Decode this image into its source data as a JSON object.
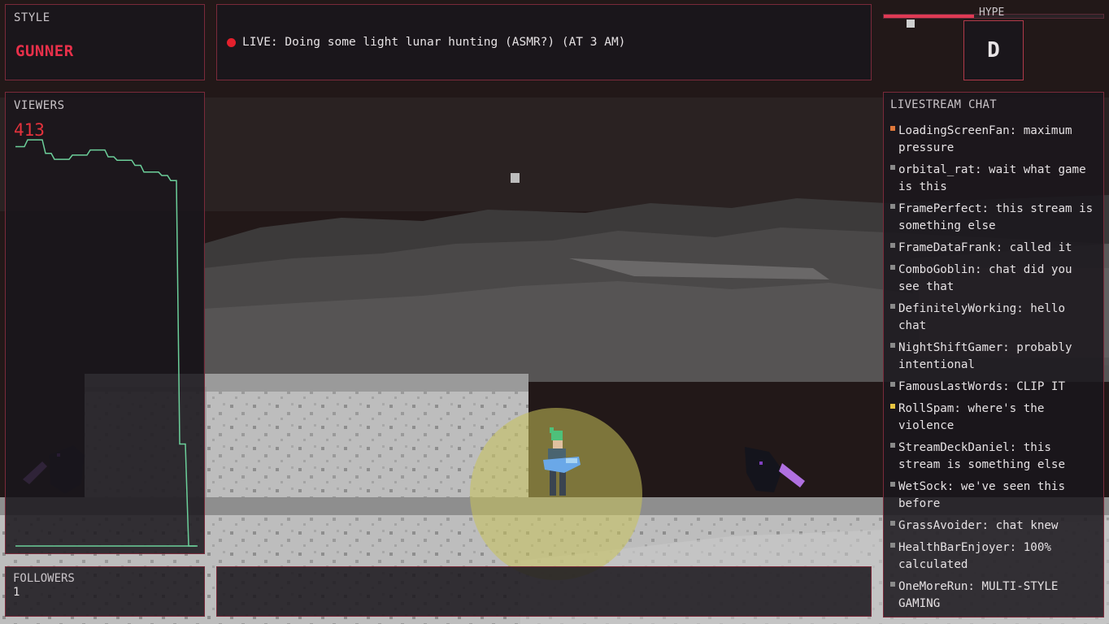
{
  "style_panel": {
    "title": "STYLE",
    "value": "GUNNER"
  },
  "live_banner": {
    "text": "LIVE: Doing some light lunar hunting (ASMR?) (AT 3 AM)",
    "dot_color": "#e4202c"
  },
  "viewers": {
    "title": "VIEWERS",
    "count": "413",
    "graph_color": "#6ccf9a",
    "history": [
      470,
      478,
      478,
      462,
      455,
      455,
      460,
      460,
      466,
      466,
      458,
      454,
      454,
      448,
      440,
      440,
      436,
      430,
      120,
      0,
      0
    ]
  },
  "followers": {
    "title": "FOLLOWERS",
    "count": "1"
  },
  "hype": {
    "label": "HYPE",
    "fill_fraction": 0.41,
    "rank": "D",
    "accent": "#e03a54"
  },
  "chat": {
    "title": "LIVESTREAM CHAT",
    "messages": [
      {
        "text": "LoadingScreenFan: maximum pressure",
        "tag_color": "#e0783a"
      },
      {
        "text": "orbital_rat: wait what game is this",
        "tag_color": "#8a8a8a"
      },
      {
        "text": "FramePerfect: this stream is something else",
        "tag_color": "#8a8a8a"
      },
      {
        "text": "FrameDataFrank: called it",
        "tag_color": "#8a8a8a"
      },
      {
        "text": "ComboGoblin: chat did you see that",
        "tag_color": "#8a8a8a"
      },
      {
        "text": "DefinitelyWorking: hello chat",
        "tag_color": "#8a8a8a"
      },
      {
        "text": "NightShiftGamer: probably intentional",
        "tag_color": "#8a8a8a"
      },
      {
        "text": "FamousLastWords: CLIP IT",
        "tag_color": "#8a8a8a"
      },
      {
        "text": "RollSpam: where's the violence",
        "tag_color": "#e8c440"
      },
      {
        "text": "StreamDeckDaniel: this stream is something else",
        "tag_color": "#8a8a8a"
      },
      {
        "text": "WetSock: we've seen this before",
        "tag_color": "#8a8a8a"
      },
      {
        "text": "GrassAvoider: chat knew",
        "tag_color": "#8a8a8a"
      },
      {
        "text": "HealthBarEnjoyer: 100% calculated",
        "tag_color": "#8a8a8a"
      },
      {
        "text": "OneMoreRun: MULTI-STYLE GAMING",
        "tag_color": "#8a8a8a"
      }
    ]
  },
  "scene": {
    "sky_color": "#221818",
    "ground_color": "#bdbdbd",
    "aura_color": "#c8c25a",
    "player_hair_color": "#4ec07a",
    "weapon_color": "#6aa8e8",
    "enemy_blade_color": "#b070e0"
  }
}
